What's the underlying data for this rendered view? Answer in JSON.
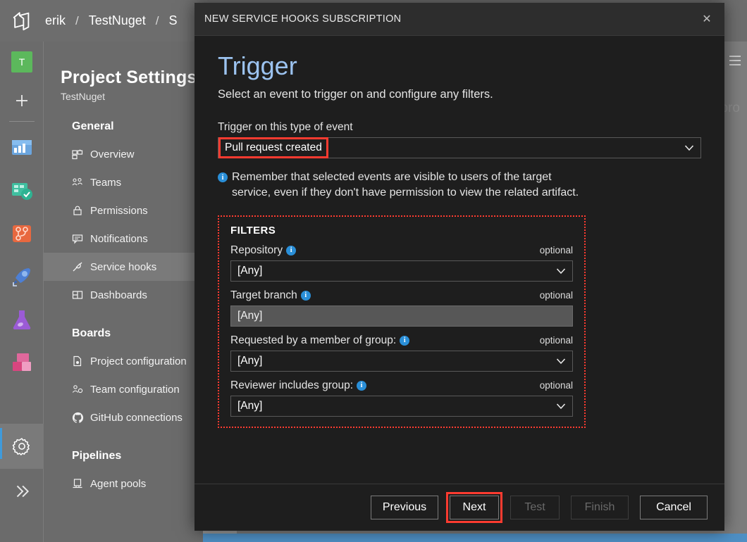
{
  "app": {
    "logo_icon": "azure-devops-logo",
    "breadcrumb": [
      {
        "label": "erik"
      },
      {
        "label": "TestNuget"
      },
      {
        "label": "S"
      }
    ],
    "breadcrumb_separator": "/",
    "hamburger_icon": "hamburger-menu-icon",
    "faint_text": "pro",
    "rail": {
      "project_avatar_initial": "T",
      "project_avatar_color": "#5cb85c",
      "add_icon": "plus-icon",
      "items": [
        {
          "icon": "overview-icon",
          "name": "overview"
        },
        {
          "icon": "boards-icon",
          "name": "boards"
        },
        {
          "icon": "repos-icon",
          "name": "repos"
        },
        {
          "icon": "pipelines-rocket-icon",
          "name": "pipelines"
        },
        {
          "icon": "test-plans-flask-icon",
          "name": "test-plans"
        },
        {
          "icon": "artifacts-icon",
          "name": "artifacts"
        }
      ],
      "settings_icon": "gear-icon",
      "expand_icon": "double-chevron-right-icon"
    },
    "sidebar": {
      "title": "Project Settings",
      "subtitle": "TestNuget",
      "groups": [
        {
          "label": "General",
          "items": [
            {
              "label": "Overview",
              "icon": "overview-grid-icon",
              "selected": false
            },
            {
              "label": "Teams",
              "icon": "teams-icon",
              "selected": false
            },
            {
              "label": "Permissions",
              "icon": "lock-icon",
              "selected": false
            },
            {
              "label": "Notifications",
              "icon": "notification-bubble-icon",
              "selected": false
            },
            {
              "label": "Service hooks",
              "icon": "service-hooks-plug-icon",
              "selected": true
            },
            {
              "label": "Dashboards",
              "icon": "dashboards-icon",
              "selected": false
            }
          ]
        },
        {
          "label": "Boards",
          "items": [
            {
              "label": "Project configuration",
              "icon": "document-gear-icon",
              "selected": false
            },
            {
              "label": "Team configuration",
              "icon": "team-gear-icon",
              "selected": false
            },
            {
              "label": "GitHub connections",
              "icon": "github-icon",
              "selected": false
            }
          ]
        },
        {
          "label": "Pipelines",
          "items": [
            {
              "label": "Agent pools",
              "icon": "agent-pool-icon",
              "selected": false
            }
          ]
        }
      ]
    }
  },
  "dialog": {
    "header_title": "NEW SERVICE HOOKS SUBSCRIPTION",
    "close_icon": "close-x-icon",
    "heading": "Trigger",
    "description": "Select an event to trigger on and configure any filters.",
    "event": {
      "label": "Trigger on this type of event",
      "value": "Pull request created",
      "chevron_icon": "chevron-down-icon",
      "highlighted": true
    },
    "note": {
      "icon": "info-icon",
      "text": "Remember that selected events are visible to users of the target service, even if they don't have permission to view the related artifact."
    },
    "filters": {
      "title": "FILTERS",
      "optional_label": "optional",
      "info_icon": "info-icon",
      "fields": [
        {
          "label": "Repository",
          "value": "[Any]",
          "type": "select",
          "has_info": true
        },
        {
          "label": "Target branch",
          "value": "[Any]",
          "type": "text",
          "has_info": true
        },
        {
          "label": "Requested by a member of group:",
          "value": "[Any]",
          "type": "select",
          "has_info": true
        },
        {
          "label": "Reviewer includes group:",
          "value": "[Any]",
          "type": "select",
          "has_info": true
        }
      ]
    },
    "footer": {
      "buttons": [
        {
          "label": "Previous",
          "disabled": false,
          "highlighted": false
        },
        {
          "label": "Next",
          "disabled": false,
          "highlighted": true
        },
        {
          "label": "Test",
          "disabled": true,
          "highlighted": false
        },
        {
          "label": "Finish",
          "disabled": true,
          "highlighted": false
        },
        {
          "label": "Cancel",
          "disabled": false,
          "highlighted": false
        }
      ]
    }
  },
  "annotation": {
    "color": "#ff3b30",
    "style": "red-highlight"
  }
}
